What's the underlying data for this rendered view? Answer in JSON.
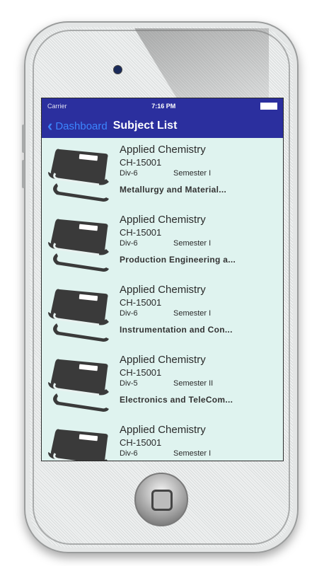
{
  "status_bar": {
    "carrier": "Carrier",
    "time": "7:16 PM"
  },
  "navbar": {
    "back_label": "Dashboard",
    "title": "Subject List"
  },
  "subjects": [
    {
      "name": "Applied Chemistry",
      "code": "CH-15001",
      "division": "Div-6",
      "semester": "Semester I",
      "department": "Metallurgy and Material..."
    },
    {
      "name": "Applied Chemistry",
      "code": "CH-15001",
      "division": "Div-6",
      "semester": "Semester I",
      "department": "Production Engineering a..."
    },
    {
      "name": "Applied Chemistry",
      "code": "CH-15001",
      "division": "Div-6",
      "semester": "Semester I",
      "department": "Instrumentation and Con..."
    },
    {
      "name": "Applied Chemistry",
      "code": "CH-15001",
      "division": "Div-5",
      "semester": "Semester II",
      "department": "Electronics and TeleCom..."
    },
    {
      "name": "Applied Chemistry",
      "code": "CH-15001",
      "division": "Div-6",
      "semester": "Semester I",
      "department": ""
    }
  ],
  "icons": {
    "book": "book-stack-icon",
    "back": "chevron-left-icon"
  },
  "colors": {
    "navbar": "#2b2f9e",
    "back_link": "#3c86ff",
    "list_bg": "#dff3ef"
  }
}
